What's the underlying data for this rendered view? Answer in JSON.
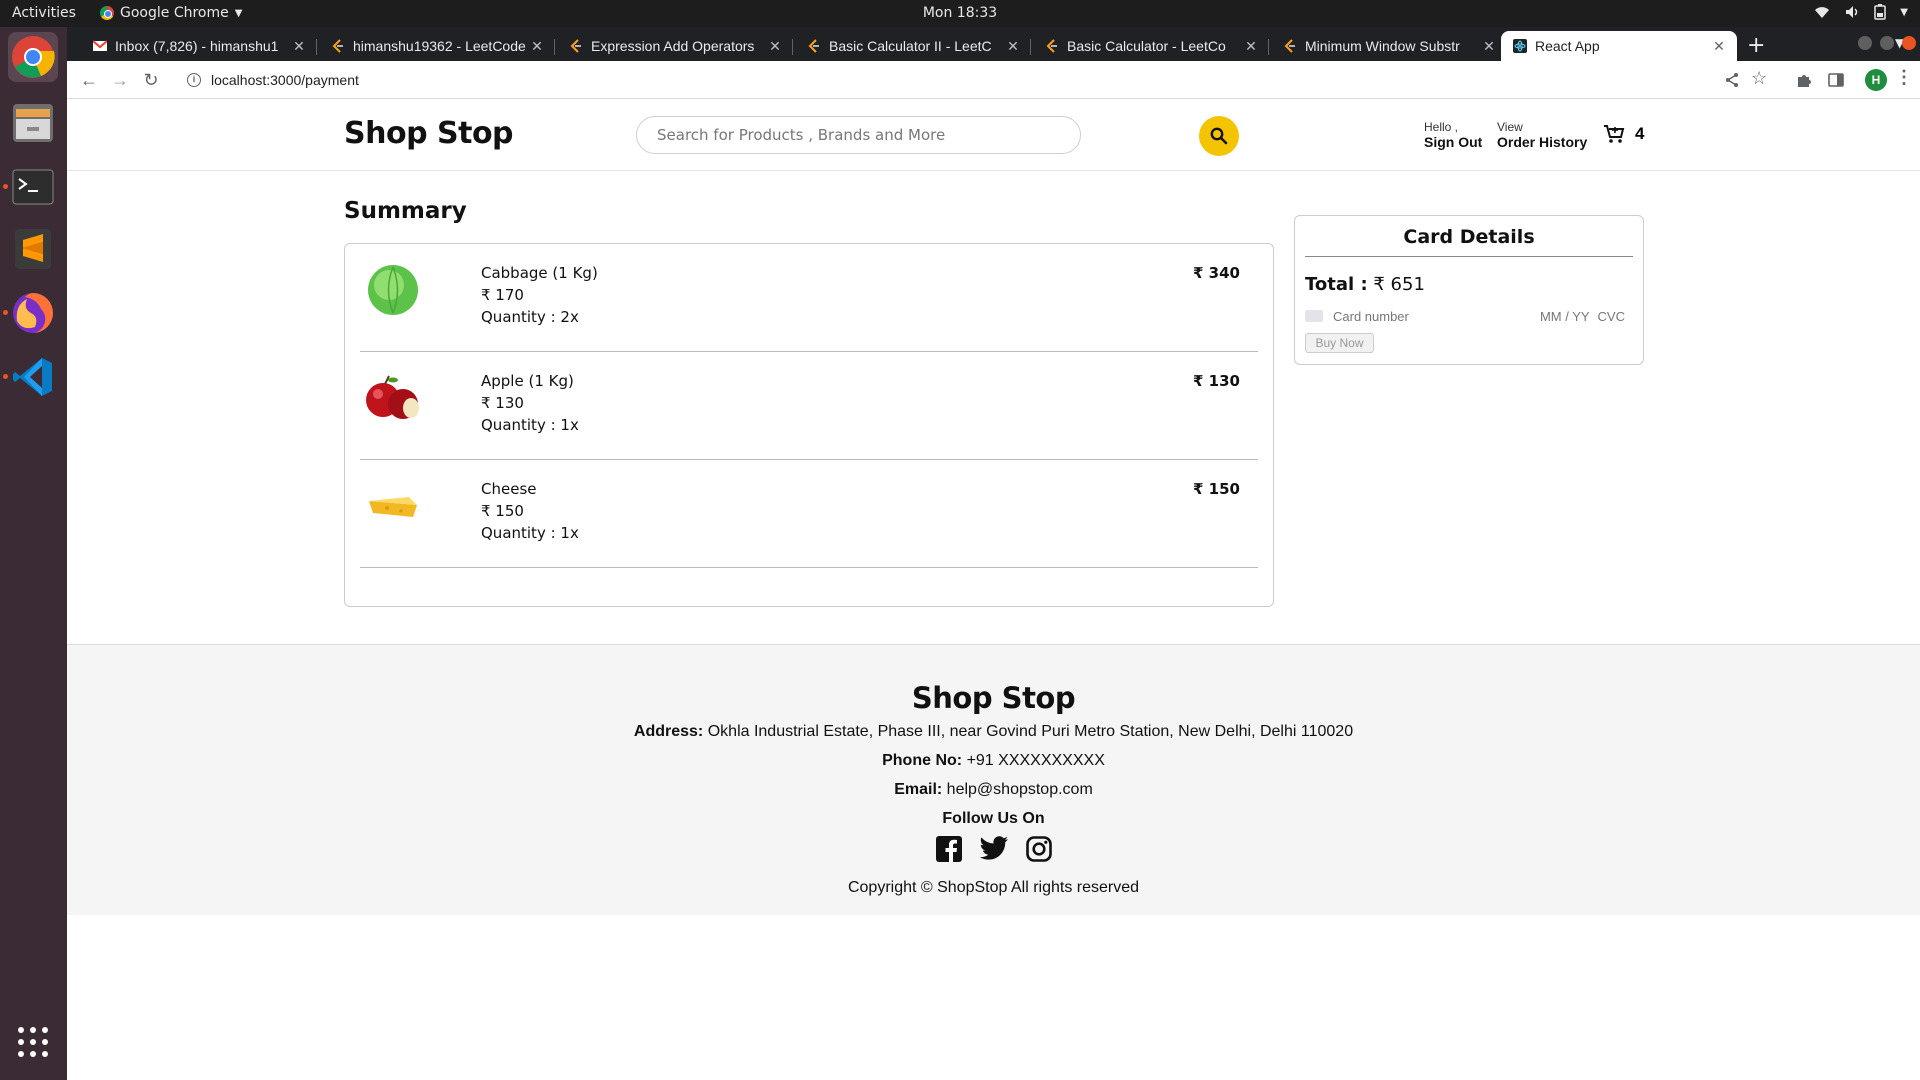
{
  "os": {
    "activities": "Activities",
    "app_name": "Google Chrome",
    "clock": "Mon 18:33"
  },
  "browser": {
    "tabs": [
      {
        "title": "Inbox (7,826) - himanshu1",
        "favicon": "gmail-icon"
      },
      {
        "title": "himanshu19362 - LeetCode",
        "favicon": "leetcode-icon"
      },
      {
        "title": "Expression Add Operators",
        "favicon": "leetcode-icon"
      },
      {
        "title": "Basic Calculator II - LeetC",
        "favicon": "leetcode-icon"
      },
      {
        "title": "Basic Calculator - LeetCo",
        "favicon": "leetcode-icon"
      },
      {
        "title": "Minimum Window Substr",
        "favicon": "leetcode-icon"
      },
      {
        "title": "React App",
        "favicon": "react-icon"
      }
    ],
    "url": "localhost:3000/payment",
    "profile_initial": "H"
  },
  "header": {
    "brand": "Shop Stop",
    "search_placeholder": "Search for Products , Brands and More",
    "hello": "Hello ,",
    "sign_out": "Sign Out",
    "view": "View",
    "order_history": "Order History",
    "cart_count": "4"
  },
  "summary": {
    "title": "Summary",
    "items": [
      {
        "name": "Cabbage (1 Kg)",
        "price": "₹ 170",
        "quantity": "Quantity : 2x",
        "total": "₹ 340",
        "image": "cabbage"
      },
      {
        "name": "Apple (1 Kg)",
        "price": "₹ 130",
        "quantity": "Quantity : 1x",
        "total": "₹ 130",
        "image": "apple"
      },
      {
        "name": "Cheese",
        "price": "₹ 150",
        "quantity": "Quantity : 1x",
        "total": "₹ 150",
        "image": "cheese"
      }
    ]
  },
  "card": {
    "title": "Card Details",
    "total_label": "Total :",
    "total_value": "₹ 651",
    "card_number_placeholder": "Card number",
    "expiry_placeholder": "MM / YY",
    "cvc_placeholder": "CVC",
    "buy_label": "Buy Now"
  },
  "footer": {
    "brand": "Shop Stop",
    "address_label": "Address:",
    "address": "Okhla Industrial Estate, Phase III, near Govind Puri Metro Station, New Delhi, Delhi 110020",
    "phone_label": "Phone No:",
    "phone": "+91 XXXXXXXXXX",
    "email_label": "Email:",
    "email": "help@shopstop.com",
    "follow": "Follow Us On",
    "copyright": "Copyright © ShopStop All rights reserved"
  },
  "colors": {
    "accent": "#f5c400",
    "dock": "#3a2b34",
    "footer_bg": "#f5f5f5"
  }
}
